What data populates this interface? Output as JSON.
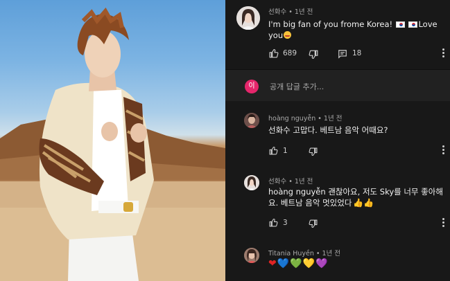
{
  "comment": {
    "author": "선화수",
    "time": "1년 전",
    "text_before_flags": "I'm big fan of you frome Korea! ",
    "text_after_flags": "Love",
    "text_line2": "you",
    "likes": "689",
    "replies": "18"
  },
  "reply_box": {
    "avatar_letter": "이",
    "avatar_color": "#e5266b",
    "placeholder": "공개 답글 추가..."
  },
  "replies": [
    {
      "author": "hoàng nguyễn",
      "time": "1년 전",
      "text": "선화수 고맙다. 베트남 음악 어때요?",
      "likes": "1"
    },
    {
      "author": "선화수",
      "time": "1년 전",
      "text_line1": "hoàng nguyễn 괜찮아요, 저도 Sky를 너무 좋아해",
      "text_line2": "요. 베트남 음악 멋있었다",
      "likes": "3"
    },
    {
      "author": "Titania Huyền",
      "time": "1년 전",
      "hearts": [
        "❤",
        "💙",
        "💚",
        "💛",
        "💜"
      ]
    }
  ],
  "colors": {
    "panel_bg": "#181818",
    "reply_box_bg": "#212121",
    "meta_text": "#aaaaaa",
    "body_text": "#f1f1f1"
  },
  "icons": [
    "thumbs-up-icon",
    "thumbs-down-icon",
    "comment-icon",
    "more-vert-icon"
  ]
}
